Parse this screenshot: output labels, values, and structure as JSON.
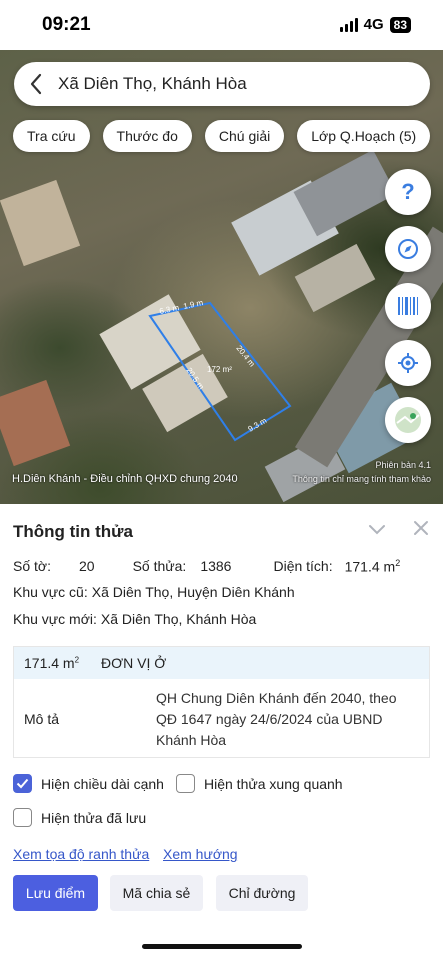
{
  "status_bar": {
    "time": "09:21",
    "network": "4G",
    "battery": "83"
  },
  "search": {
    "title": "Xã Diên Thọ, Khánh Hòa"
  },
  "chips": [
    {
      "label": "Tra cứu"
    },
    {
      "label": "Thước đo"
    },
    {
      "label": "Chú giải"
    },
    {
      "label": "Lớp Q.Hoạch (5)"
    }
  ],
  "map_tools": [
    {
      "icon": "help-icon"
    },
    {
      "icon": "compass-icon"
    },
    {
      "icon": "barcode-icon"
    },
    {
      "icon": "locate-icon"
    },
    {
      "icon": "map-layer-icon"
    }
  ],
  "parcel_overlay": {
    "edges": [
      "6.3 m",
      "1.9 m",
      "20.4 m",
      "9.3 m",
      "20.5 m"
    ],
    "area": "172 m²"
  },
  "map_caption": "H.Diên Khánh - Điều chỉnh QHXD chung 2040",
  "map_scale": {
    "label": "Phiên bản 4.1",
    "note": "Thông tin chỉ mang tính tham khảo"
  },
  "panel": {
    "title": "Thông tin thửa",
    "sheet_label": "Số tờ:",
    "sheet_value": "20",
    "parcel_label": "Số thửa:",
    "parcel_value": "1386",
    "area_label": "Diện tích:",
    "area_value": "171.4 m",
    "area_unit_sup": "2",
    "old_area_label": "Khu vực cũ:",
    "old_area_value": "Xã Diên Thọ, Huyện Diên Khánh",
    "new_area_label": "Khu vực mới:",
    "new_area_value": "Xã Diên Thọ, Khánh Hòa",
    "zone_area": "171.4 m",
    "zone_area_sup": "2",
    "zone_type": "ĐƠN VỊ Ở",
    "desc_label": "Mô tả",
    "desc_value": "QH Chung Diên Khánh đến 2040, theo QĐ 1647 ngày 24/6/2024 của UBND Khánh Hòa"
  },
  "options": {
    "show_edge_length": {
      "label": "Hiện chiều dài cạnh",
      "checked": true
    },
    "show_nearby": {
      "label": "Hiện thửa xung quanh",
      "checked": false
    },
    "show_saved": {
      "label": "Hiện thửa đã lưu",
      "checked": false
    }
  },
  "links": {
    "coords": "Xem tọa độ ranh thửa",
    "direction": "Xem hướng"
  },
  "actions": {
    "save": "Lưu điểm",
    "share": "Mã chia sẻ",
    "route": "Chỉ đường"
  },
  "colors": {
    "accent": "#4c5fe0",
    "link": "#3657c9",
    "parcel_outline": "#2f7fe8",
    "zone_header": "#eaf4fb"
  }
}
